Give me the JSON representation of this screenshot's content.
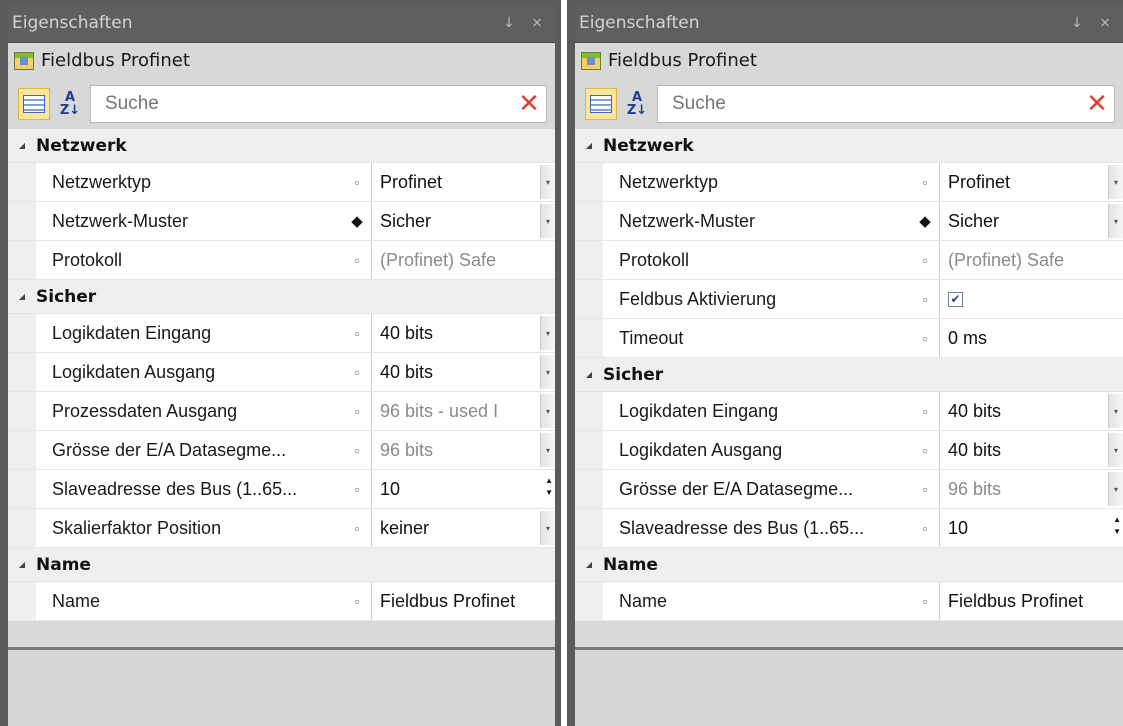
{
  "panels": [
    {
      "title": "Eigenschaften",
      "pin": "↓",
      "close": "×",
      "object_title": "Fieldbus Profinet",
      "search_placeholder": "Suche",
      "categories": [
        {
          "label": "Netzwerk",
          "rows": [
            {
              "name": "Netzwerktyp",
              "value": "Profinet",
              "marker": "default",
              "editor": "dropdown",
              "readonly": false
            },
            {
              "name": "Netzwerk-Muster",
              "value": "Sicher",
              "marker": "modified",
              "editor": "dropdown",
              "readonly": false
            },
            {
              "name": "Protokoll",
              "value": "(Profinet) Safe",
              "marker": "default",
              "editor": "text",
              "readonly": true
            }
          ]
        },
        {
          "label": "Sicher",
          "rows": [
            {
              "name": "Logikdaten Eingang",
              "value": "40 bits",
              "marker": "default",
              "editor": "dropdown",
              "readonly": false
            },
            {
              "name": "Logikdaten Ausgang",
              "value": "40 bits",
              "marker": "default",
              "editor": "dropdown",
              "readonly": false
            },
            {
              "name": "Prozessdaten Ausgang",
              "value": "96 bits - used I",
              "marker": "default",
              "editor": "dropdown",
              "readonly": true
            },
            {
              "name": "Grösse der E/A Datasegme...",
              "value": "96 bits",
              "marker": "default",
              "editor": "dropdown",
              "readonly": true
            },
            {
              "name": "Slaveadresse des Bus (1..65...",
              "value": "10",
              "marker": "default",
              "editor": "spinner",
              "readonly": false
            },
            {
              "name": "Skalierfaktor Position",
              "value": "keiner",
              "marker": "default",
              "editor": "dropdown",
              "readonly": false
            }
          ]
        },
        {
          "label": "Name",
          "rows": [
            {
              "name": "Name",
              "value": "Fieldbus Profinet",
              "marker": "default",
              "editor": "text",
              "readonly": false
            }
          ]
        }
      ]
    },
    {
      "title": "Eigenschaften",
      "pin": "↓",
      "close": "×",
      "object_title": "Fieldbus Profinet",
      "search_placeholder": "Suche",
      "categories": [
        {
          "label": "Netzwerk",
          "rows": [
            {
              "name": "Netzwerktyp",
              "value": "Profinet",
              "marker": "default",
              "editor": "dropdown",
              "readonly": false
            },
            {
              "name": "Netzwerk-Muster",
              "value": "Sicher",
              "marker": "modified",
              "editor": "dropdown",
              "readonly": false
            },
            {
              "name": "Protokoll",
              "value": "(Profinet) Safe",
              "marker": "default",
              "editor": "text",
              "readonly": true
            },
            {
              "name": "Feldbus Aktivierung",
              "value": "",
              "checked": true,
              "marker": "default",
              "editor": "checkbox",
              "readonly": false
            },
            {
              "name": "Timeout",
              "value": "0 ms",
              "marker": "default",
              "editor": "text",
              "readonly": false
            }
          ]
        },
        {
          "label": "Sicher",
          "rows": [
            {
              "name": "Logikdaten Eingang",
              "value": "40 bits",
              "marker": "default",
              "editor": "dropdown",
              "readonly": false
            },
            {
              "name": "Logikdaten Ausgang",
              "value": "40 bits",
              "marker": "default",
              "editor": "dropdown",
              "readonly": false
            },
            {
              "name": "Grösse der E/A Datasegme...",
              "value": "96 bits",
              "marker": "default",
              "editor": "dropdown",
              "readonly": true
            },
            {
              "name": "Slaveadresse des Bus (1..65...",
              "value": "10",
              "marker": "default",
              "editor": "spinner",
              "readonly": false
            }
          ]
        },
        {
          "label": "Name",
          "rows": [
            {
              "name": "Name",
              "value": "Fieldbus Profinet",
              "marker": "default",
              "editor": "text",
              "readonly": false
            }
          ]
        }
      ]
    }
  ]
}
